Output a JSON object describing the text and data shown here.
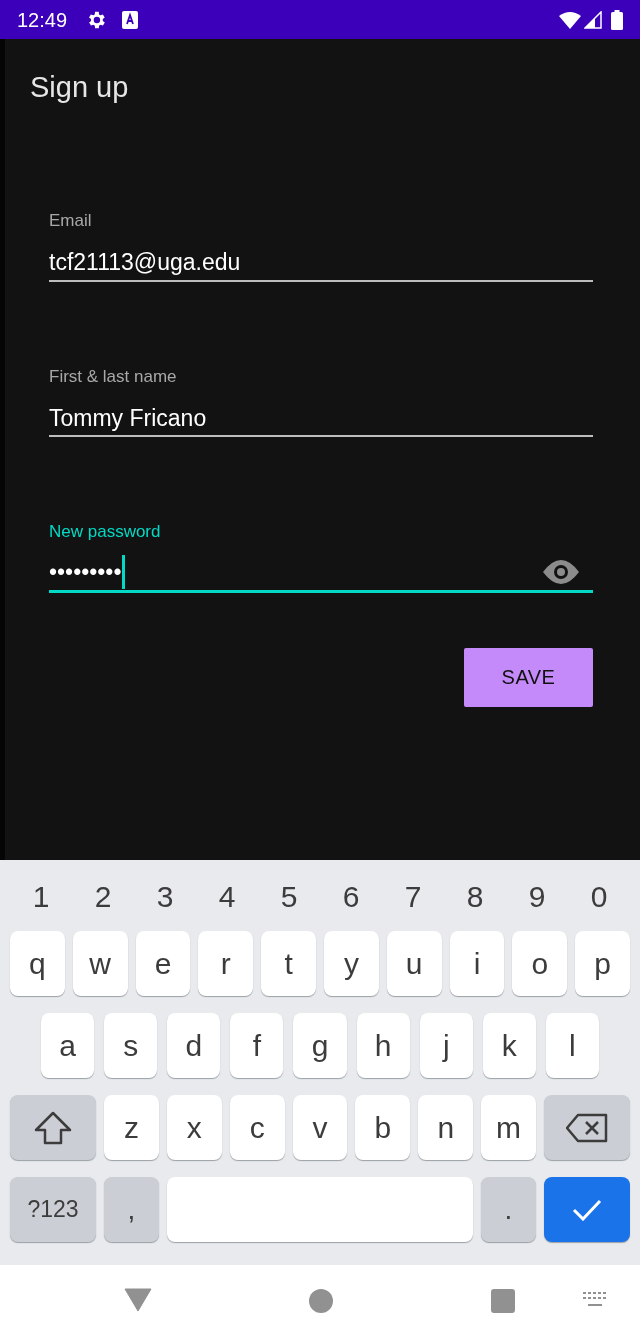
{
  "status_bar": {
    "time": "12:49"
  },
  "app_bar": {
    "title": "Sign up"
  },
  "fields": [
    {
      "kind": "text",
      "label": "Email",
      "value": "tcf21113@uga.edu",
      "focused": false
    },
    {
      "kind": "text",
      "label": "First & last name",
      "value": "Tommy Fricano",
      "focused": false
    },
    {
      "kind": "password",
      "label": "New password",
      "value": "•••••••••",
      "focused": true
    }
  ],
  "save_button": {
    "label": "SAVE"
  },
  "keyboard": {
    "number_row": [
      "1",
      "2",
      "3",
      "4",
      "5",
      "6",
      "7",
      "8",
      "9",
      "0"
    ],
    "top_letters": [
      "q",
      "w",
      "e",
      "r",
      "t",
      "y",
      "u",
      "i",
      "o",
      "p"
    ],
    "middle_letters": [
      "a",
      "s",
      "d",
      "f",
      "g",
      "h",
      "j",
      "k",
      "l"
    ],
    "bottom_letters": [
      "z",
      "x",
      "c",
      "v",
      "b",
      "n",
      "m"
    ],
    "symbols_key": "?123",
    "comma_key": ",",
    "period_key": "."
  }
}
